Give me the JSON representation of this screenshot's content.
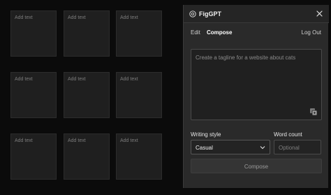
{
  "canvas": {
    "stickies": [
      {
        "placeholder": "Add text"
      },
      {
        "placeholder": "Add text"
      },
      {
        "placeholder": "Add text"
      },
      {
        "placeholder": "Add text"
      },
      {
        "placeholder": "Add text"
      },
      {
        "placeholder": "Add text"
      },
      {
        "placeholder": "Add text"
      },
      {
        "placeholder": "Add text"
      },
      {
        "placeholder": "Add text"
      }
    ]
  },
  "panel": {
    "title": "FigGPT",
    "tabs": [
      {
        "label": "Edit",
        "active": false
      },
      {
        "label": "Compose",
        "active": true
      }
    ],
    "logout_label": "Log Out",
    "prompt": {
      "value": "",
      "placeholder": "Create a tagline for a website about cats"
    },
    "writing_style": {
      "label": "Writing style",
      "selected": "Casual"
    },
    "word_count": {
      "label": "Word count",
      "value": "",
      "placeholder": "Optional"
    },
    "compose_button_label": "Compose"
  },
  "colors": {
    "background": "#0b0b0b",
    "panel": "#2a2a2a",
    "sticky": "#1f1f1f"
  }
}
